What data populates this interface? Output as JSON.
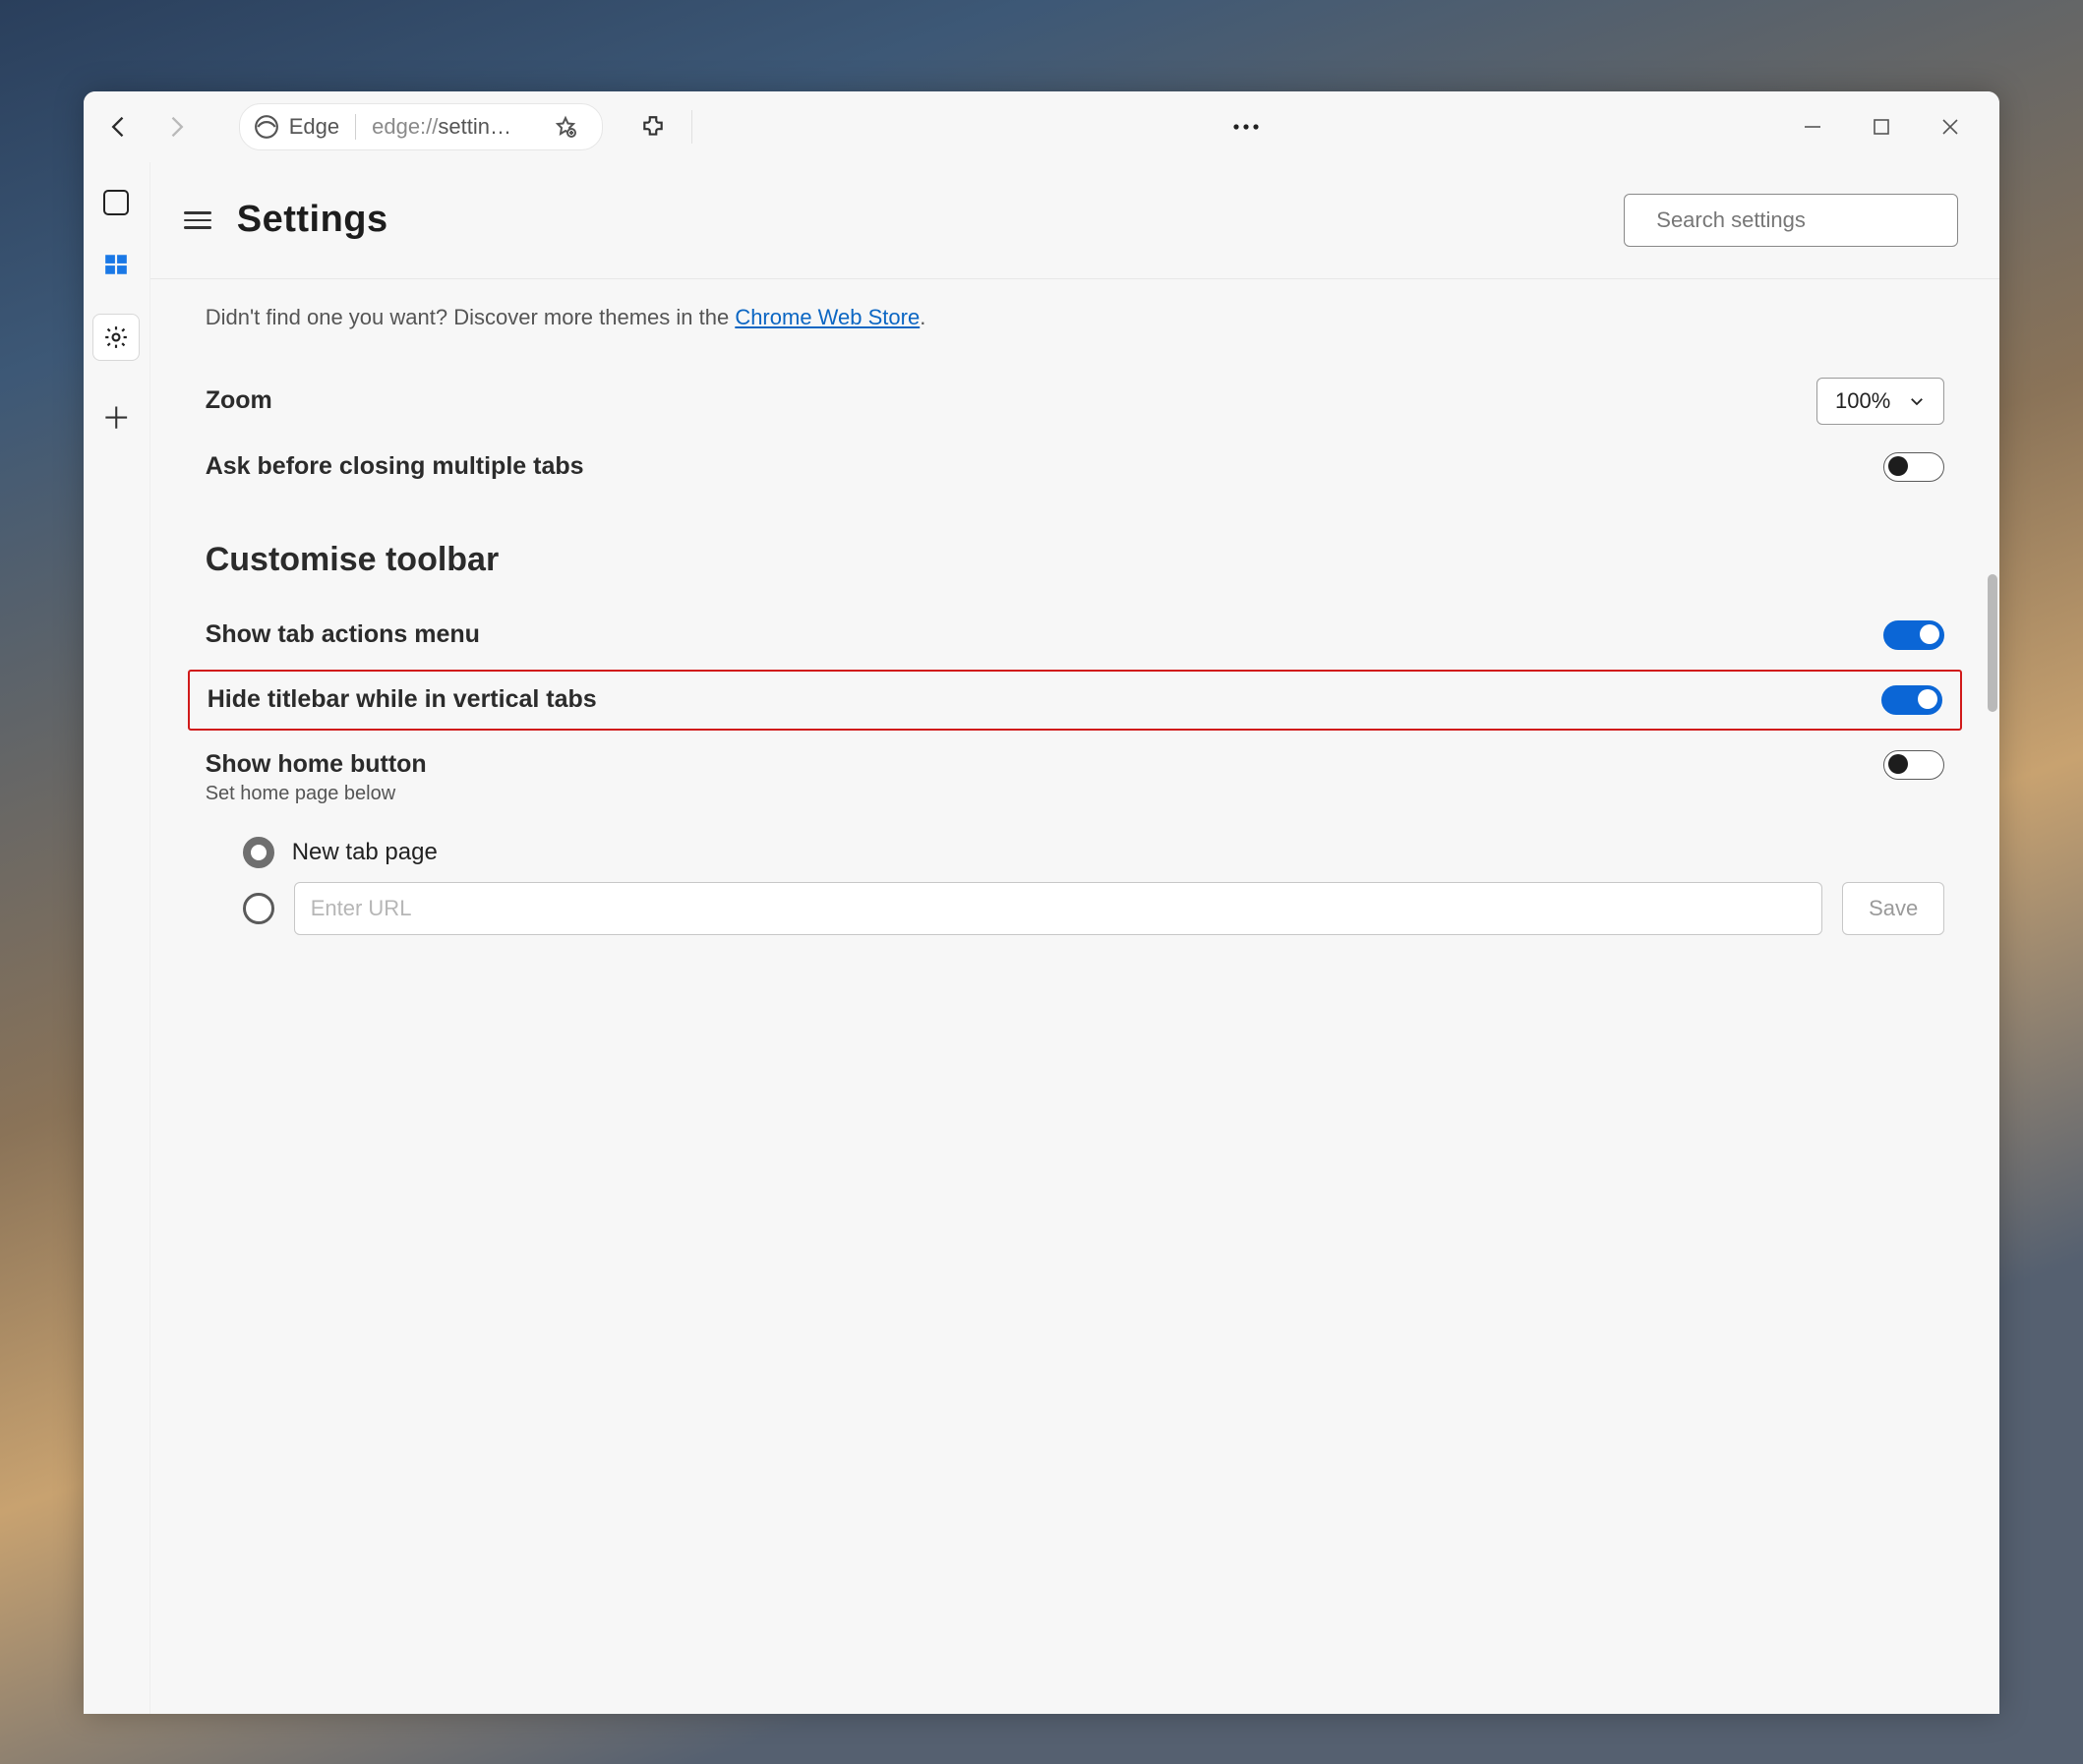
{
  "titlebar": {
    "brand": "Edge",
    "url_prefix": "edge://",
    "url_rest": "settin…"
  },
  "sidebar": {},
  "header": {
    "title": "Settings",
    "search_placeholder": "Search settings"
  },
  "hint": {
    "text_before": "Didn't find one you want? Discover more themes in the ",
    "link": "Chrome Web Store",
    "text_after": "."
  },
  "zoom": {
    "label": "Zoom",
    "value": "100%"
  },
  "ask_close": {
    "label": "Ask before closing multiple tabs",
    "on": false
  },
  "section_toolbar": "Customise toolbar",
  "tab_actions": {
    "label": "Show tab actions menu",
    "on": true
  },
  "hide_titlebar": {
    "label": "Hide titlebar while in vertical tabs",
    "on": true
  },
  "home_button": {
    "label": "Show home button",
    "sub": "Set home page below",
    "on": false
  },
  "home_options": {
    "new_tab": "New tab page",
    "url_placeholder": "Enter URL",
    "save": "Save"
  }
}
